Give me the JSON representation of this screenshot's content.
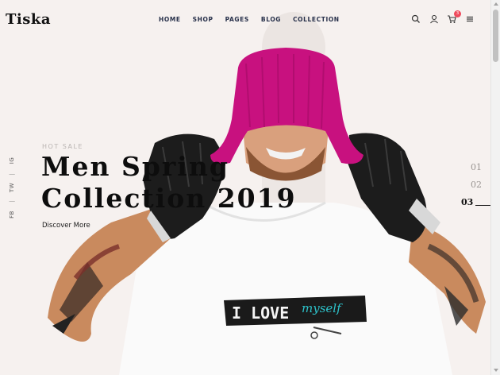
{
  "header": {
    "logo": "Tiska",
    "nav": [
      {
        "label": "HOME"
      },
      {
        "label": "SHOP"
      },
      {
        "label": "PAGES"
      },
      {
        "label": "BLOG"
      },
      {
        "label": "COLLECTION"
      }
    ],
    "cart_count": "3",
    "icons": [
      "search-icon",
      "user-icon",
      "cart-icon",
      "menu-icon"
    ]
  },
  "hero": {
    "eyebrow": "HOT SALE",
    "title_line1": "Men Spring",
    "title_line2": "Collection 2019",
    "cta": "Discover More"
  },
  "social": {
    "items": [
      "FB",
      "TW",
      "IG"
    ],
    "separator": "|"
  },
  "pager": {
    "slides": [
      "01",
      "02",
      "03"
    ],
    "active": "03"
  },
  "colors": {
    "background": "#f6f1ef",
    "beanie": "#c8117f",
    "badge": "#ef4a5c",
    "nav_text": "#27304a"
  }
}
